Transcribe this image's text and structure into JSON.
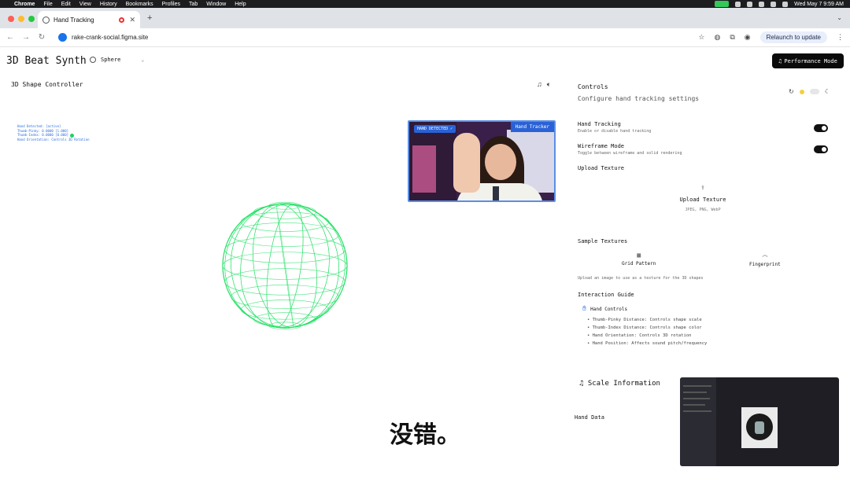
{
  "menubar": {
    "items": [
      "Chrome",
      "File",
      "Edit",
      "View",
      "History",
      "Bookmarks",
      "Profiles",
      "Tab",
      "Window",
      "Help"
    ],
    "datetime": "Wed May 7  9:59 AM"
  },
  "browser": {
    "tab_title": "Hand Tracking",
    "url": "rake-crank-social.figma.site",
    "relaunch_label": "Relaunch to update"
  },
  "app": {
    "title": "3D Beat Synth",
    "shape_selected": "Sphere",
    "performance_mode": "Performance Mode"
  },
  "panel": {
    "title": "3D Shape Controller",
    "debug_lines": [
      "Hand Detected: [active]",
      "Thumb-Pinky: 0.0000 [1.000]",
      "Thumb-Index: 0.0000 [0.000]",
      "Hand Orientation: Controls 3D Rotation"
    ],
    "wire_color": "#22e065"
  },
  "webcam": {
    "hand_detected": "HAND DETECTED ✓",
    "hand_tracker": "Hand Tracker"
  },
  "controls": {
    "title": "Controls",
    "subtitle": "Configure hand tracking settings",
    "hand_tracking": {
      "label": "Hand Tracking",
      "desc": "Enable or disable hand tracking",
      "on": true
    },
    "wireframe": {
      "label": "Wireframe Mode",
      "desc": "Toggle between wireframe and solid rendering",
      "on": true
    },
    "upload_section": "Upload Texture",
    "upload_label": "Upload Texture",
    "upload_formats": "JPEG, PNG, WebP",
    "sample_section": "Sample Textures",
    "samples": [
      {
        "label": "Grid Pattern",
        "icon": "grid-icon"
      },
      {
        "label": "Fingerprint",
        "icon": "fingerprint-icon"
      }
    ],
    "hint": "Upload an image to use as a texture for the 3D shapes",
    "guide_title": "Interaction Guide",
    "guide_sub": "Hand Controls",
    "guide_items": [
      "Thumb-Pinky Distance: Controls shape scale",
      "Thumb-Index Distance: Controls shape color",
      "Hand Orientation: Controls 3D rotation",
      "Hand Position: Affects sound pitch/frequency"
    ],
    "scale_info": "Scale Information",
    "hand_data": "Hand Data"
  },
  "caption": "没错。"
}
